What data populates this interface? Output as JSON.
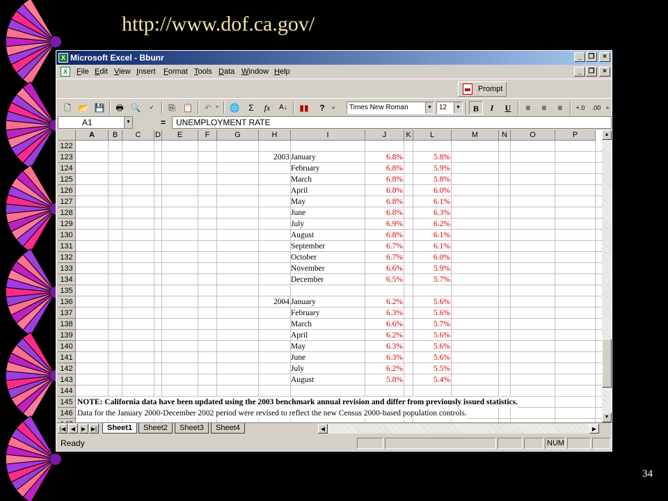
{
  "slide": {
    "url": "http://www.dof.ca.gov/",
    "number": "34"
  },
  "window": {
    "title": "Microsoft Excel - Bbunr"
  },
  "menu": [
    "File",
    "Edit",
    "View",
    "Insert",
    "Format",
    "Tools",
    "Data",
    "Window",
    "Help"
  ],
  "toolbar": {
    "prompt_label": "Prompt",
    "font_name": "Times New Roman",
    "font_size": "12"
  },
  "formula_bar": {
    "name_box": "A1",
    "equals": "=",
    "content": "UNEMPLOYMENT RATE"
  },
  "columns": [
    "A",
    "B",
    "C",
    "D",
    "E",
    "F",
    "G",
    "H",
    "I",
    "J",
    "K",
    "L",
    "M",
    "N",
    "O",
    "P"
  ],
  "rows": [
    {
      "num": "122"
    },
    {
      "num": "123",
      "year": "2003",
      "month": "January",
      "j": "6.8%",
      "l": "5.8%"
    },
    {
      "num": "124",
      "month": "February",
      "j": "6.8%",
      "l": "5.9%"
    },
    {
      "num": "125",
      "month": "March",
      "j": "6.8%",
      "l": "5.8%"
    },
    {
      "num": "126",
      "month": "April",
      "j": "6.8%",
      "l": "6.0%"
    },
    {
      "num": "127",
      "month": "May",
      "j": "6.8%",
      "l": "6.1%"
    },
    {
      "num": "128",
      "month": "June",
      "j": "6.8%",
      "l": "6.3%"
    },
    {
      "num": "129",
      "month": "July",
      "j": "6.9%",
      "l": "6.2%"
    },
    {
      "num": "130",
      "month": "August",
      "j": "6.8%",
      "l": "6.1%"
    },
    {
      "num": "131",
      "month": "September",
      "j": "6.7%",
      "l": "6.1%"
    },
    {
      "num": "132",
      "month": "October",
      "j": "6.7%",
      "l": "6.0%"
    },
    {
      "num": "133",
      "month": "November",
      "j": "6.6%",
      "l": "5.9%"
    },
    {
      "num": "134",
      "month": "December",
      "j": "6.5%",
      "l": "5.7%"
    },
    {
      "num": "135"
    },
    {
      "num": "136",
      "year": "2004",
      "month": "January",
      "j": "6.2%",
      "l": "5.6%"
    },
    {
      "num": "137",
      "month": "February",
      "j": "6.3%",
      "l": "5.6%"
    },
    {
      "num": "138",
      "month": "March",
      "j": "6.6%",
      "l": "5.7%"
    },
    {
      "num": "139",
      "month": "April",
      "j": "6.2%",
      "l": "5.6%"
    },
    {
      "num": "140",
      "month": "May",
      "j": "6.3%",
      "l": "5.6%"
    },
    {
      "num": "141",
      "month": "June",
      "j": "6.3%",
      "l": "5.6%"
    },
    {
      "num": "142",
      "month": "July",
      "j": "6.2%",
      "l": "5.5%"
    },
    {
      "num": "143",
      "month": "August",
      "j": "5.8%",
      "l": "5.4%"
    },
    {
      "num": "144"
    },
    {
      "num": "145",
      "note": "NOTE: California data have been updated using the 2003 benchmark annual revision and differ from previously issued statistics.",
      "bold": true
    },
    {
      "num": "146",
      "note": "Data for the January 2000-December 2002 period were revised to reflect the new Census 2000-based population controls."
    },
    {
      "num": "147"
    }
  ],
  "sheets": [
    "Sheet1",
    "Sheet2",
    "Sheet3",
    "Sheet4"
  ],
  "status": {
    "ready": "Ready",
    "num": "NUM"
  },
  "colors": {
    "title_start": "#0a246a",
    "title_end": "#a6caf0",
    "data_red": "#d40000",
    "slide_url": "#f3e2a0"
  }
}
